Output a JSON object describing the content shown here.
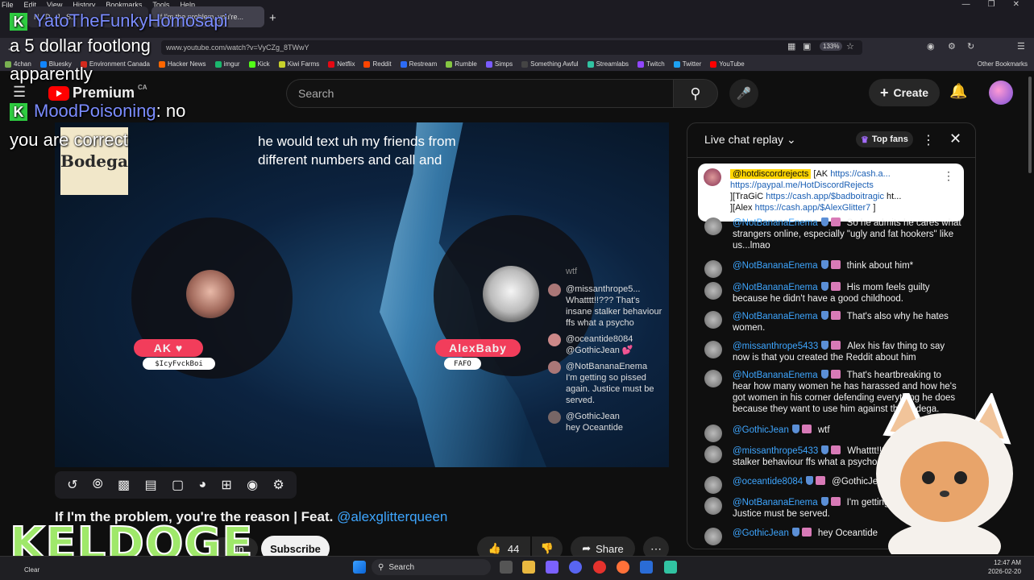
{
  "browser": {
    "menu": [
      "File",
      "Edit",
      "View",
      "History",
      "Bookmarks",
      "Tools",
      "Help"
    ],
    "tabs": [
      {
        "label": "H...D...J...S..."
      },
      {
        "label": "If I'm the problem, you're..."
      }
    ],
    "new_tab": "+",
    "url": "www.youtube.com/watch?v=VyCZg_8TWwY",
    "zoom": "133%",
    "bookmarks": [
      {
        "label": "4chan",
        "color": "#79b051"
      },
      {
        "label": "Bluesky",
        "color": "#1185fe"
      },
      {
        "label": "Environment Canada",
        "color": "#d52b1e"
      },
      {
        "label": "Hacker News",
        "color": "#ff6600"
      },
      {
        "label": "imgur",
        "color": "#1bb76e"
      },
      {
        "label": "Kick",
        "color": "#53fc18"
      },
      {
        "label": "Kiwi Farms",
        "color": "#c7d12b"
      },
      {
        "label": "Netflix",
        "color": "#e50914"
      },
      {
        "label": "Reddit",
        "color": "#ff4500"
      },
      {
        "label": "Restream",
        "color": "#2d6cf6"
      },
      {
        "label": "Rumble",
        "color": "#85c742"
      },
      {
        "label": "Simps",
        "color": "#7a5cff"
      },
      {
        "label": "Something Awful",
        "color": "#444444"
      },
      {
        "label": "Streamlabs",
        "color": "#31c3a2"
      },
      {
        "label": "Twitch",
        "color": "#9146ff"
      },
      {
        "label": "Twitter",
        "color": "#1da1f2"
      },
      {
        "label": "YouTube",
        "color": "#ff0000"
      }
    ],
    "other_bookmarks": "Other Bookmarks"
  },
  "youtube": {
    "logo": "Premium",
    "region": "CA",
    "search_placeholder": "Search",
    "create_label": "Create",
    "caption": "he would text uh my friends from\ndifferent numbers and call and",
    "bodega_label": "Bodega",
    "host_left": {
      "name": "AK ♥",
      "handle": "$IcyFvckBoi"
    },
    "host_right": {
      "name": "AlexBaby",
      "handle": "FAFO"
    },
    "video_chat": [
      {
        "user": "",
        "text": "wtf"
      },
      {
        "user": "@missanthrope5...",
        "text": "Whatttt!!??? That's insane stalker behaviour ffs what a psycho"
      },
      {
        "user": "@oceantide8084",
        "text": "@GothicJean 💕"
      },
      {
        "user": "@NotBananaEnema",
        "text": "I'm getting so pissed again. Justice must be served."
      },
      {
        "user": "@GothicJean",
        "text": "hey Oceantide"
      }
    ],
    "video_title": "If I'm the problem, you're the reason | Feat.",
    "video_title_link": "@alexglitterqueen",
    "join_label": "Join",
    "subscribe_label": "Subscribe",
    "likes": "44",
    "share_label": "Share"
  },
  "live_chat": {
    "title": "Live chat replay",
    "top_fans": "Top fans",
    "pinned": {
      "user": "@hotdiscordrejects",
      "line1": "[AK ",
      "link1": "https://cash.a...",
      "link2": "https://paypal.me/HotDiscordRejects",
      "line3": "][TraGiC ",
      "link3": "https://cash.app/$badboitragic",
      "line3b": " ht...",
      "line4": "][Alex ",
      "link4": "https://cash.app/$AlexGlitter7",
      "line4b": " ]"
    },
    "messages": [
      {
        "user": "@NotBananaEnema",
        "text": "So he admits he cares what strangers online, especially \"ugly and fat hookers\" like us...lmao"
      },
      {
        "user": "@NotBananaEnema",
        "text": "think about him*"
      },
      {
        "user": "@NotBananaEnema",
        "text": "His mom feels guilty because he didn't have a good childhood."
      },
      {
        "user": "@NotBananaEnema",
        "text": "That's also why he hates women."
      },
      {
        "user": "@missanthrope5433",
        "text": "Alex his fav thing to say now is that you created the Reddit about him"
      },
      {
        "user": "@NotBananaEnema",
        "text": "That's heartbreaking to hear how many women he has harassed and how he's got women in his corner defending everything he does because they want to use him against the bodega."
      },
      {
        "user": "@GothicJean",
        "text": "wtf"
      },
      {
        "user": "@missanthrope5433",
        "text": "Whatttt!!??? That's insane stalker behaviour ffs what a psycho"
      },
      {
        "user": "@oceantide8084",
        "text": "@GothicJean 💕"
      },
      {
        "user": "@NotBananaEnema",
        "text": "I'm getting so pissed again. Justice must be served."
      },
      {
        "user": "@GothicJean",
        "text": "hey Oceantide"
      }
    ]
  },
  "overlay": {
    "line1_user": "YatoTheFunkyHomosapi",
    "line1_text": "a 5 dollar footlong",
    "line2_text": "apparently",
    "line3_user": "MoodPoisoning",
    "line3_text": ": no",
    "line4_text": "you are correct",
    "streamer": "KELDOGE"
  },
  "taskbar": {
    "weather": "Clear",
    "search": "Search",
    "time": "12:47 AM",
    "date": "2026-02-20"
  }
}
